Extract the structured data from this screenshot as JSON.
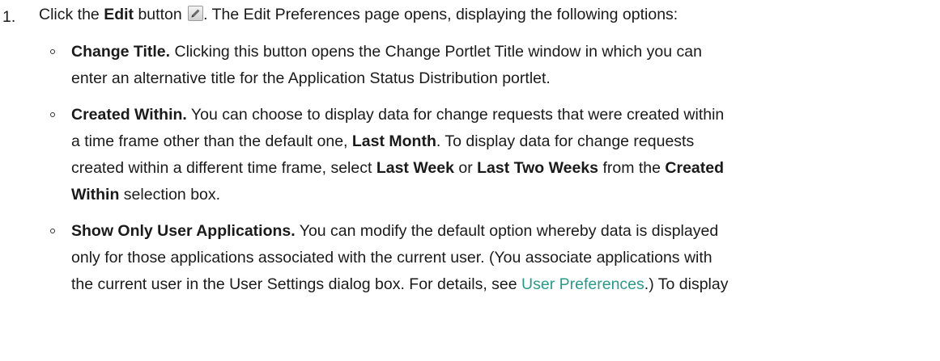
{
  "step": {
    "number": "1.",
    "pre": "Click the ",
    "edit_label": "Edit",
    "post_button": " button",
    "post_icon": ". The Edit Preferences page opens, displaying the following options:",
    "icon": "edit-pencil-icon"
  },
  "options": [
    {
      "title": "Change Title.",
      "line1": " Clicking this button opens the Change Portlet Title window in which you can",
      "line2": "enter an alternative title for the Application Status Distribution portlet."
    },
    {
      "title": "Created Within.",
      "line1": " You can choose to display data for change requests that were created within",
      "line2a": "a time frame other than the default one, ",
      "line2b": "Last Month",
      "line2c": ". To display data for change requests",
      "line3a": "created within a different time frame, select ",
      "line3b": "Last Week",
      "line3c": " or ",
      "line3d": "Last Two Weeks",
      "line3e": " from the ",
      "line3f": "Created",
      "line4a": "Within",
      "line4b": " selection box."
    },
    {
      "title": "Show Only User Applications.",
      "line1": " You can modify the default option whereby data is displayed",
      "line2": "only for those applications associated with the current user. (You associate applications with",
      "line3a": "the current user in the User Settings dialog box. For details, see ",
      "line3_link": "User Preferences",
      "line3b": ".) To display"
    }
  ],
  "colors": {
    "text": "#1a1a1a",
    "link": "#2a9a8a"
  }
}
